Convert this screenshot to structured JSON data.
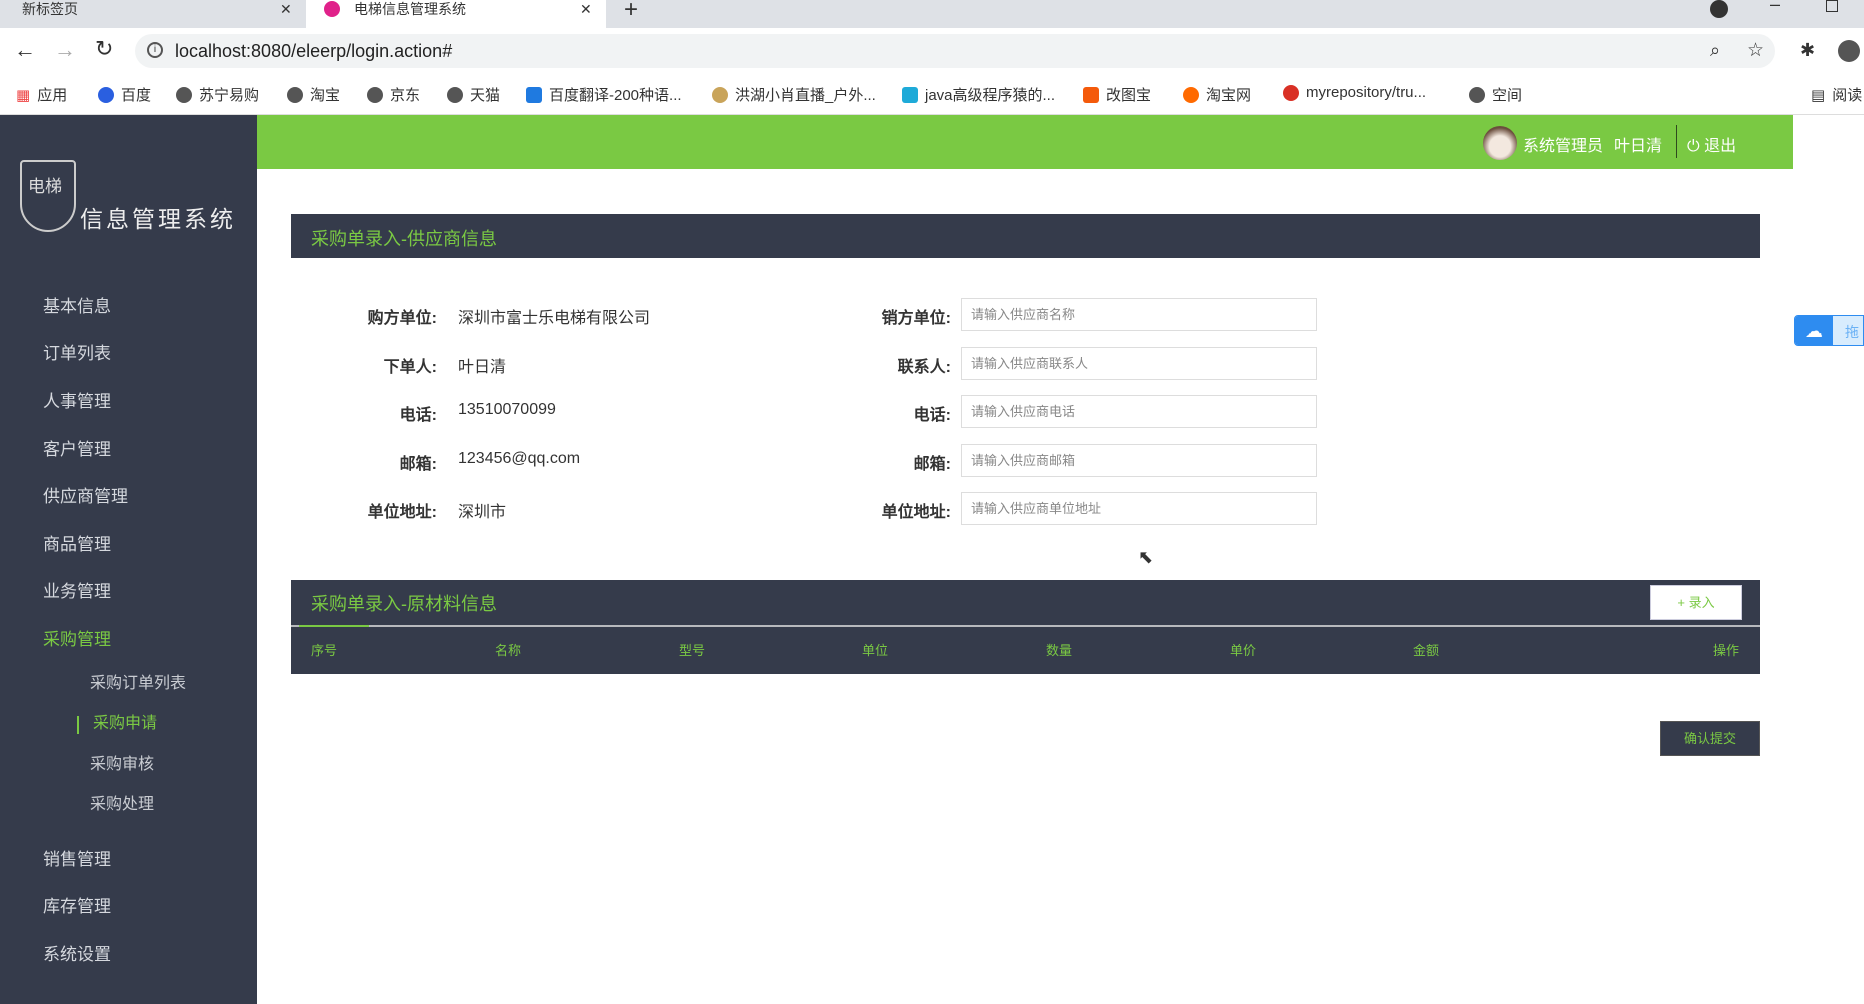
{
  "browser": {
    "tabs": [
      {
        "label": "新标签页"
      },
      {
        "label": "电梯信息管理系统"
      }
    ],
    "url": "localhost:8080/eleerp/login.action#",
    "bookmarks": [
      "应用",
      "百度",
      "苏宁易购",
      "淘宝",
      "京东",
      "天猫",
      "百度翻译-200种语...",
      "洪湖小肖直播_户外...",
      "java高级程序猿的...",
      "改图宝",
      "淘宝网",
      "myrepository/tru...",
      "空间",
      "阅读"
    ]
  },
  "logo": {
    "text": "信息管理系统",
    "badge": "电梯"
  },
  "header": {
    "role": "系统管理员",
    "user": "叶日清",
    "logout": "退出"
  },
  "sidebar": {
    "items": [
      "基本信息",
      "订单列表",
      "人事管理",
      "客户管理",
      "供应商管理",
      "商品管理",
      "业务管理",
      "采购管理"
    ],
    "sub": [
      "采购订单列表",
      "采购申请",
      "采购审核",
      "采购处理"
    ],
    "items2": [
      "销售管理",
      "库存管理",
      "系统设置"
    ]
  },
  "supplier": {
    "title": "采购单录入-供应商信息",
    "left": [
      {
        "label": "购方单位:",
        "value": "深圳市富士乐电梯有限公司"
      },
      {
        "label": "下单人:",
        "value": "叶日清"
      },
      {
        "label": "电话:",
        "value": "13510070099"
      },
      {
        "label": "邮箱:",
        "value": "123456@qq.com"
      },
      {
        "label": "单位地址:",
        "value": "深圳市"
      }
    ],
    "right": [
      {
        "label": "销方单位:",
        "placeholder": "请输入供应商名称"
      },
      {
        "label": "联系人:",
        "placeholder": "请输入供应商联系人"
      },
      {
        "label": "电话:",
        "placeholder": "请输入供应商电话"
      },
      {
        "label": "邮箱:",
        "placeholder": "请输入供应商邮箱"
      },
      {
        "label": "单位地址:",
        "placeholder": "请输入供应商单位地址"
      }
    ]
  },
  "materials": {
    "title": "采购单录入-原材料信息",
    "add": "录入",
    "columns": [
      "序号",
      "名称",
      "型号",
      "单位",
      "数量",
      "单价",
      "金额",
      "操作"
    ]
  },
  "submit": "确认提交",
  "widget": {
    "label": "拖"
  }
}
